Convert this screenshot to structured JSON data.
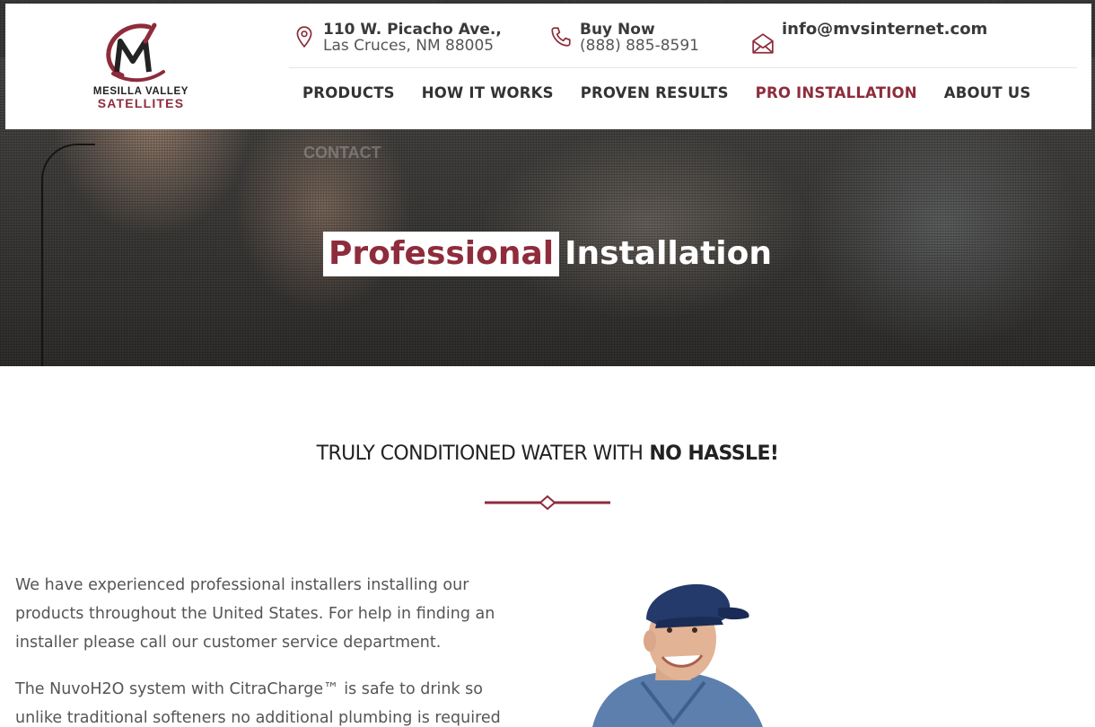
{
  "brand": {
    "logo_text_top": "MESILLA VALLEY",
    "logo_text_bottom": "SATELLITES",
    "colors": {
      "accent": "#8e2c3c",
      "text_dark": "#333333",
      "text_body": "#555555"
    }
  },
  "header": {
    "address": {
      "icon": "map-pin-icon",
      "line1": "110 W. Picacho Ave.,",
      "line2": "Las Cruces, NM 88005"
    },
    "phone": {
      "icon": "phone-icon",
      "line1": "Buy Now",
      "line2": "(888) 885-8591"
    },
    "email": {
      "icon": "envelope-icon",
      "line1": "info@mvsinternet.com"
    }
  },
  "nav": {
    "items": [
      {
        "label": "PRODUCTS",
        "active": false
      },
      {
        "label": "HOW IT WORKS",
        "active": false
      },
      {
        "label": "PROVEN RESULTS",
        "active": false
      },
      {
        "label": "PRO INSTALLATION",
        "active": true
      },
      {
        "label": "ABOUT US",
        "active": false
      },
      {
        "label": "CONTACT",
        "active": false
      }
    ]
  },
  "hero": {
    "title_highlight": "Professional",
    "title_rest": "Installation"
  },
  "section": {
    "heading_light": "TRULY CONDITIONED WATER WITH",
    "heading_bold": "NO HASSLE!",
    "paragraphs": [
      "We have experienced professional installers installing our products throughout the United States. For help in finding an installer please call our customer service department.",
      "The NuvoH2O system with CitraCharge™ is safe to drink so unlike traditional softeners no additional plumbing is required"
    ]
  }
}
